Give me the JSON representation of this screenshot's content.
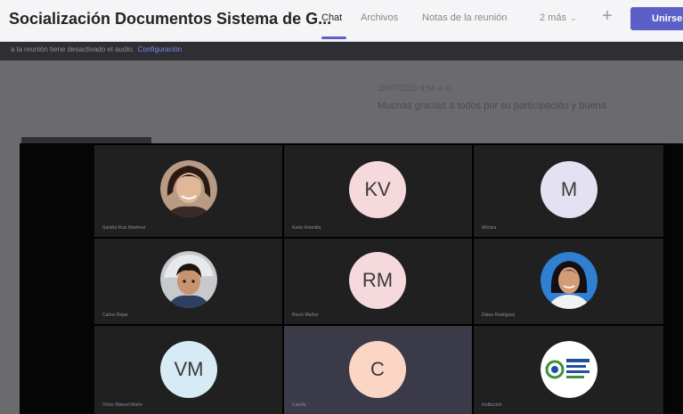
{
  "header": {
    "title": "Socialización Documentos Sistema de G...",
    "tabs": [
      {
        "label": "Chat",
        "active": true
      },
      {
        "label": "Archivos"
      },
      {
        "label": "Notas de la reunión"
      },
      {
        "label": "2 más"
      }
    ],
    "join_label": "Unirse",
    "accent_color": "#5b5fc7"
  },
  "notice": {
    "text": "a la reunión tiene desactivado el audio.",
    "link": "Configuración"
  },
  "chat": {
    "message": {
      "sender": "28/07/2020 9:56 a.m.",
      "text": "Muchas gracias a todos por su participación y buena"
    }
  },
  "video": {
    "participants": [
      {
        "initials": "",
        "name": "Sandra Ruiz Martínez",
        "avatar": "photo-woman-icon"
      },
      {
        "initials": "KV",
        "name": "Karla Velandia",
        "color": "#f6d9dc"
      },
      {
        "initials": "M",
        "name": "Mónica",
        "color": "#e4e2f2"
      },
      {
        "initials": "",
        "name": "Carlos Rojas",
        "avatar": "photo-child-icon"
      },
      {
        "initials": "RM",
        "name": "Rocío Muñoz",
        "color": "#f6d9dc"
      },
      {
        "initials": "",
        "name": "Diana Rodríguez",
        "avatar": "photo-woman-icon"
      },
      {
        "initials": "VM",
        "name": "Víctor Manuel Marín",
        "color": "#d6ebf3"
      },
      {
        "initials": "C",
        "name": "Camila",
        "color": "#fbd6c4"
      },
      {
        "initials": "",
        "name": "Institución",
        "avatar": "organization-logo-icon"
      }
    ]
  }
}
